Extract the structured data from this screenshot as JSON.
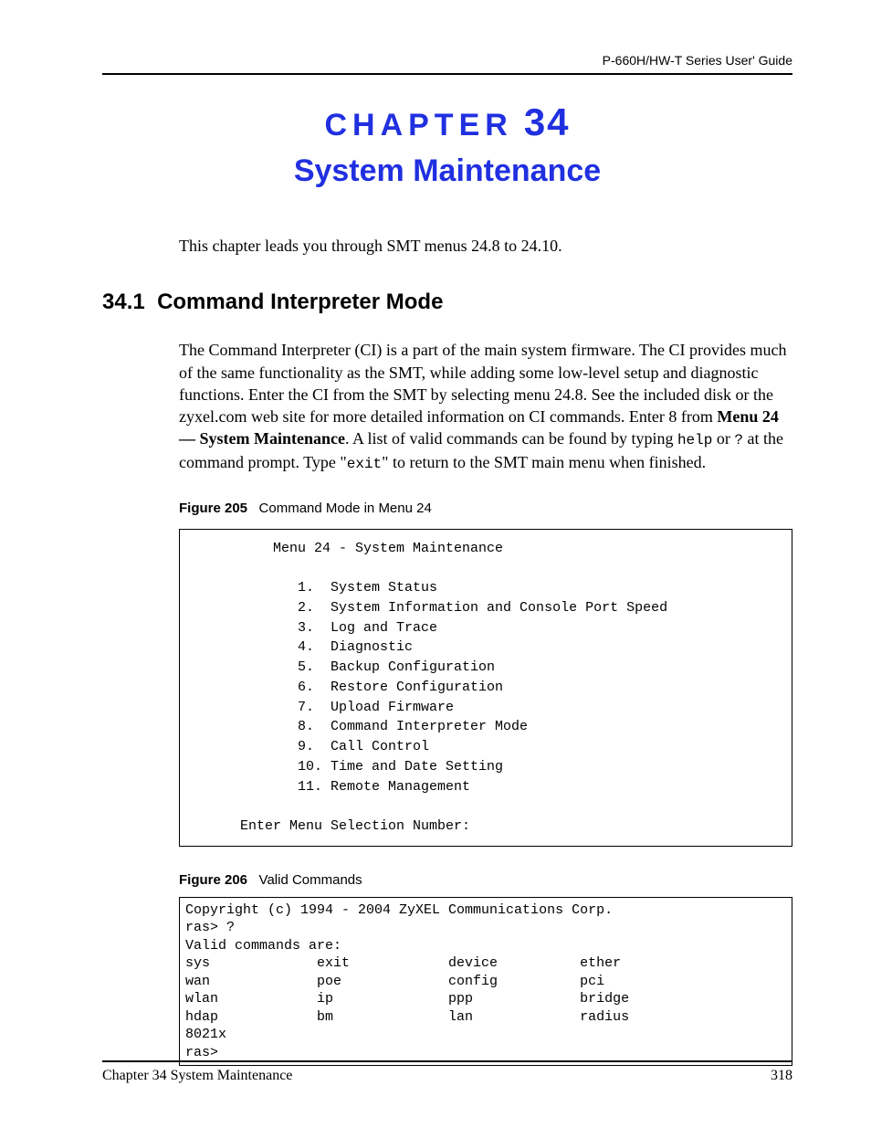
{
  "header": {
    "guide_title": "P-660H/HW-T Series User' Guide"
  },
  "chapter": {
    "label": "CHAPTER",
    "number": "34",
    "title": "System Maintenance"
  },
  "intro": "This chapter leads you through SMT menus 24.8 to 24.10.",
  "section": {
    "number": "34.1",
    "title": "Command Interpreter Mode"
  },
  "body_html": "The Command Interpreter (CI) is a part of the main system firmware. The CI provides much of the same functionality as the SMT, while adding some low-level setup and diagnostic functions. Enter the CI from the SMT by selecting menu 24.8. See the included disk or the zyxel.com web site for more detailed information on CI commands. Enter 8 from <span class=\"bold\">Menu 24 — System Maintenance</span>. A list of valid commands can be found by typing <span class=\"code\">help</span> or <span class=\"code\">?</span> at the command prompt. Type \"<span class=\"code\">exit</span>\" to return to the SMT main menu when finished.",
  "figure205": {
    "label": "Figure 205",
    "caption": "Command Mode in Menu 24",
    "content": "          Menu 24 - System Maintenance\n\n             1.  System Status\n             2.  System Information and Console Port Speed\n             3.  Log and Trace\n             4.  Diagnostic\n             5.  Backup Configuration\n             6.  Restore Configuration\n             7.  Upload Firmware\n             8.  Command Interpreter Mode\n             9.  Call Control\n             10. Time and Date Setting\n             11. Remote Management\n\n      Enter Menu Selection Number:"
  },
  "figure206": {
    "label": "Figure 206",
    "caption": "Valid Commands",
    "content": "Copyright (c) 1994 - 2004 ZyXEL Communications Corp.\nras> ?\nValid commands are:\nsys             exit            device          ether\nwan             poe             config          pci\nwlan            ip              ppp             bridge\nhdap            bm              lan             radius\n8021x\nras>"
  },
  "footer": {
    "left": "Chapter 34 System Maintenance",
    "right": "318"
  }
}
